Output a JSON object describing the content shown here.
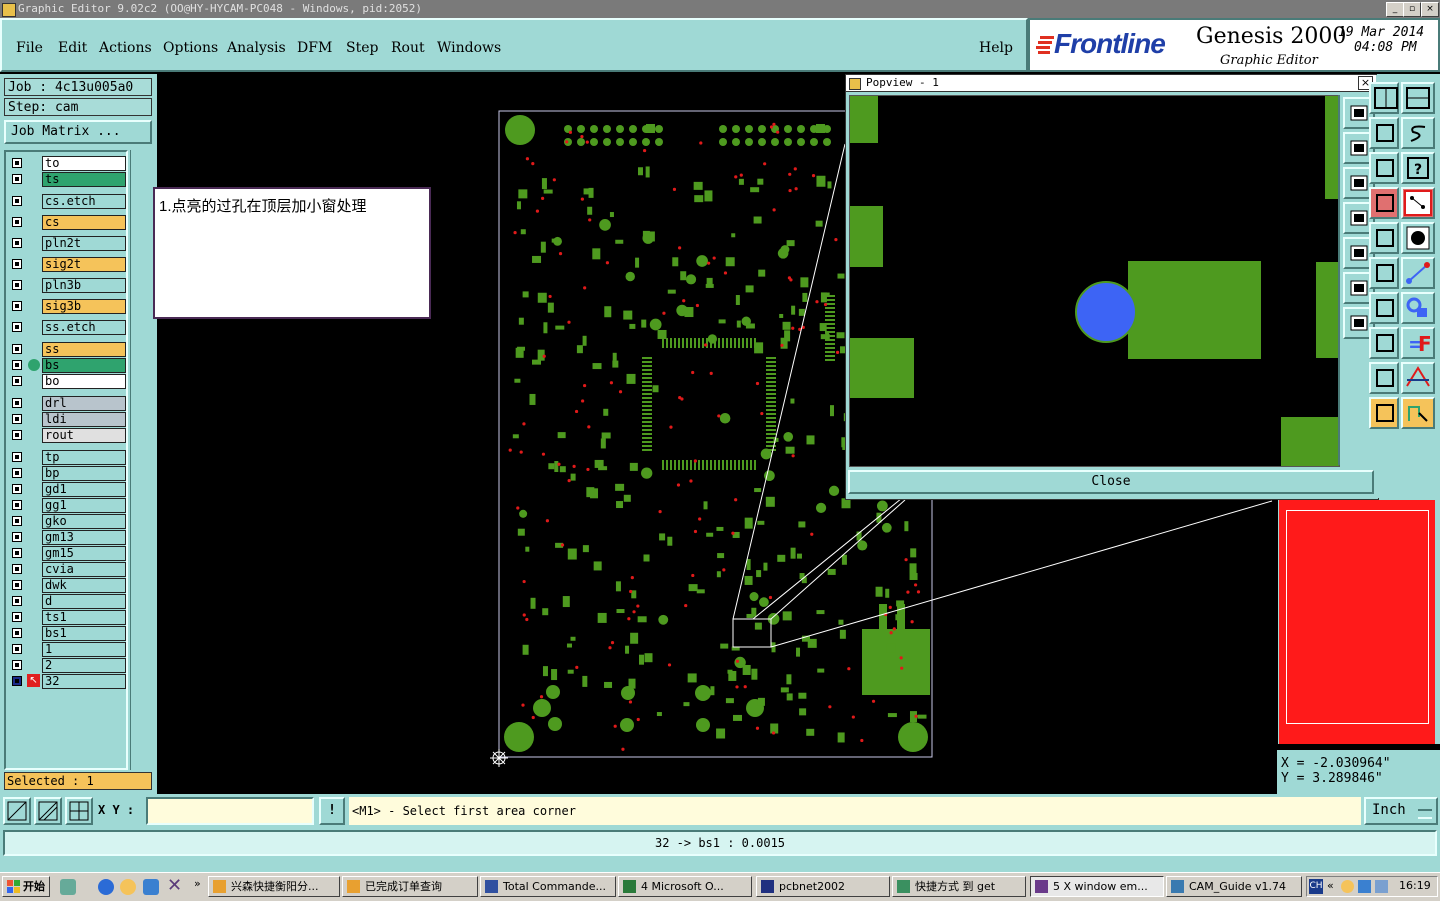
{
  "window": {
    "title": "Graphic Editor 9.02c2 (OO@HY-HYCAM-PC048 - Windows, pid:2052)"
  },
  "menu": {
    "items": [
      "File",
      "Edit",
      "Actions",
      "Options",
      "Analysis",
      "DFM",
      "Step",
      "Rout",
      "Windows"
    ],
    "help": "Help"
  },
  "logo": {
    "brand": "Frontline",
    "product": "Genesis 2000",
    "subtitle": "Graphic Editor",
    "date": "19 Mar 2014",
    "time": "04:08 PM"
  },
  "job": {
    "job_label": "Job : 4c13u005a0",
    "step_label": "Step: cam",
    "matrix_button": "Job Matrix ..."
  },
  "layers": [
    {
      "name": "to",
      "color": "#ffffff"
    },
    {
      "name": "ts",
      "color": "#2fa36e"
    },
    {
      "name": "cs.etch",
      "color": "#9fd9d5"
    },
    {
      "name": "cs",
      "color": "#f5c35a"
    },
    {
      "name": "pln2t",
      "color": "#9fd9d5"
    },
    {
      "name": "sig2t",
      "color": "#f5c35a"
    },
    {
      "name": "pln3b",
      "color": "#9fd9d5"
    },
    {
      "name": "sig3b",
      "color": "#f5c35a"
    },
    {
      "name": "ss.etch",
      "color": "#9fd9d5"
    },
    {
      "name": "ss",
      "color": "#f5c35a"
    },
    {
      "name": "bs",
      "color": "#2fa36e"
    },
    {
      "name": "bo",
      "color": "#ffffff"
    },
    {
      "name": "drl",
      "color": "#b8c4cc"
    },
    {
      "name": "ldi",
      "color": "#b8c4cc"
    },
    {
      "name": "rout",
      "color": "#e0e0e0"
    },
    {
      "name": "tp",
      "color": "#9fd9d5"
    },
    {
      "name": "bp",
      "color": "#9fd9d5"
    },
    {
      "name": "gd1",
      "color": "#9fd9d5"
    },
    {
      "name": "gg1",
      "color": "#9fd9d5"
    },
    {
      "name": "gko",
      "color": "#9fd9d5"
    },
    {
      "name": "gm13",
      "color": "#9fd9d5"
    },
    {
      "name": "gm15",
      "color": "#9fd9d5"
    },
    {
      "name": "cvia",
      "color": "#9fd9d5"
    },
    {
      "name": "dwk",
      "color": "#9fd9d5"
    },
    {
      "name": "d",
      "color": "#9fd9d5"
    },
    {
      "name": "ts1",
      "color": "#9fd9d5"
    },
    {
      "name": "bs1",
      "color": "#9fd9d5"
    },
    {
      "name": "1",
      "color": "#9fd9d5"
    },
    {
      "name": "2",
      "color": "#9fd9d5"
    },
    {
      "name": "32",
      "color": "#9fd9d5"
    }
  ],
  "selected": "Selected : 1",
  "annotation": "1.点亮的过孔在顶层加小窗处理",
  "popview": {
    "title": "Popview - 1",
    "close": "Close"
  },
  "coords": {
    "x": "X = -2.030964\"",
    "y": "Y = 3.289846\""
  },
  "command": {
    "xy_label": "X Y :",
    "xy_value": "",
    "prompt": "<M1> - Select first area corner",
    "units": "Inch"
  },
  "status": "32 -> bs1 : 0.0015",
  "taskbar": {
    "start": "开始",
    "tasks": [
      "兴森快捷衡阳分...",
      "已完成订单查询",
      "Total Commande...",
      "4 Microsoft O...",
      "pcbnet2002",
      "快捷方式 到 get",
      "5 X window em...",
      "CAM_Guide v1.74"
    ],
    "clock": "16:19"
  },
  "colors": {
    "panel": "#9fd9d5",
    "copper": "#4e9a1f",
    "via": "#e01a1a",
    "highlight": "#3d64f5"
  }
}
